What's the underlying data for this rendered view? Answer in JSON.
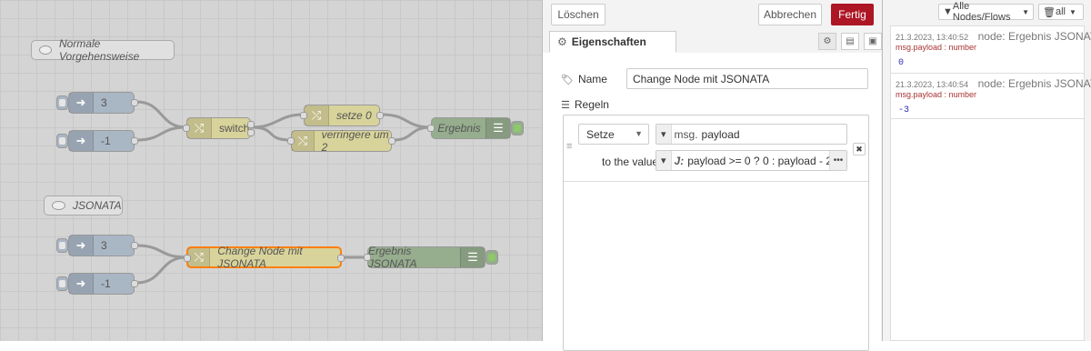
{
  "canvas": {
    "comment1": "Normale Vorgehensweise",
    "comment2": "JSONATA",
    "inject1": "3",
    "inject2": "-1",
    "switch_label": "switch",
    "change1": "setze 0",
    "change2": "verringere um 2",
    "debug1": "Ergebnis",
    "inject3": "3",
    "inject4": "-1",
    "change3": "Change Node mit JSONATA",
    "debug2": "Ergebnis JSONATA"
  },
  "editor": {
    "delete_label": "Löschen",
    "cancel_label": "Abbrechen",
    "done_label": "Fertig",
    "tab_label": "Eigenschaften",
    "name_label": "Name",
    "name_value": "Change Node mit JSONATA",
    "rules_label": "Regeln",
    "rule": {
      "action": "Setze",
      "target_prefix": "msg.",
      "target_value": "payload",
      "to_label": "to the value",
      "expr_prefix": "J:",
      "expr_value": "payload >= 0 ? 0 : payload - 2"
    }
  },
  "sidebar": {
    "filter_label": "Alle Nodes/Flows",
    "scope_label": "all",
    "messages": [
      {
        "time": "21.3.2023, 13:40:52",
        "node": "node: Ergebnis JSONATA",
        "path": "msg.payload : number",
        "value": "0"
      },
      {
        "time": "21.3.2023, 13:40:54",
        "node": "node: Ergebnis JSONATA",
        "path": "msg.payload : number",
        "value": "-3"
      }
    ]
  },
  "colors": {
    "primary": "#ad1625",
    "inject": "#a9b6c4",
    "change": "#d8d39a",
    "debug": "#96ad8e",
    "selection": "#ff7f0e"
  },
  "icons": [
    "arrow-in-icon",
    "shuffle-icon",
    "list-icon",
    "gear-icon",
    "tag-icon",
    "comment-icon"
  ]
}
